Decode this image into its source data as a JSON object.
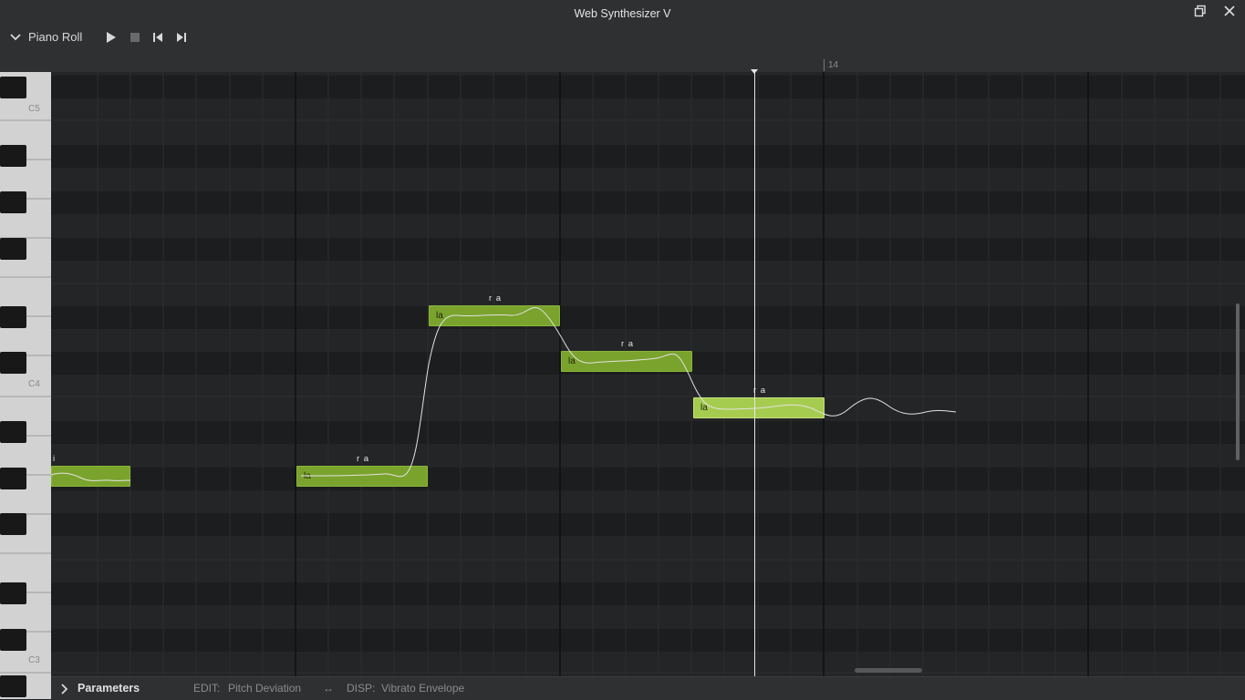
{
  "window": {
    "title": "Web Synthesizer V"
  },
  "toolbar": {
    "panel_label": "Piano Roll",
    "icons": [
      "chevron-down-icon",
      "play-icon",
      "stop-icon",
      "skip-back-icon",
      "skip-forward-icon"
    ]
  },
  "ruler": {
    "measure_label": "14"
  },
  "keyboard": {
    "labels": {
      "c5": "C5",
      "c4": "C4",
      "c3": "C3"
    }
  },
  "notes": [
    {
      "lyric": "",
      "phoneme": "i"
    },
    {
      "lyric": "la",
      "phoneme": "r a"
    },
    {
      "lyric": "la",
      "phoneme": "r a"
    },
    {
      "lyric": "la",
      "phoneme": "r a"
    },
    {
      "lyric": "la",
      "phoneme": "r a",
      "selected": true
    }
  ],
  "bottom": {
    "parameters_label": "Parameters",
    "edit_label": "EDIT:",
    "edit_value": "Pitch Deviation",
    "swap_symbol": "↔",
    "disp_label": "DISP:",
    "disp_value": "Vibrato Envelope"
  },
  "colors": {
    "note": "#7aa32d",
    "note_selected": "#a6cc4f",
    "background": "#1f2021",
    "chrome": "#2f3032"
  }
}
